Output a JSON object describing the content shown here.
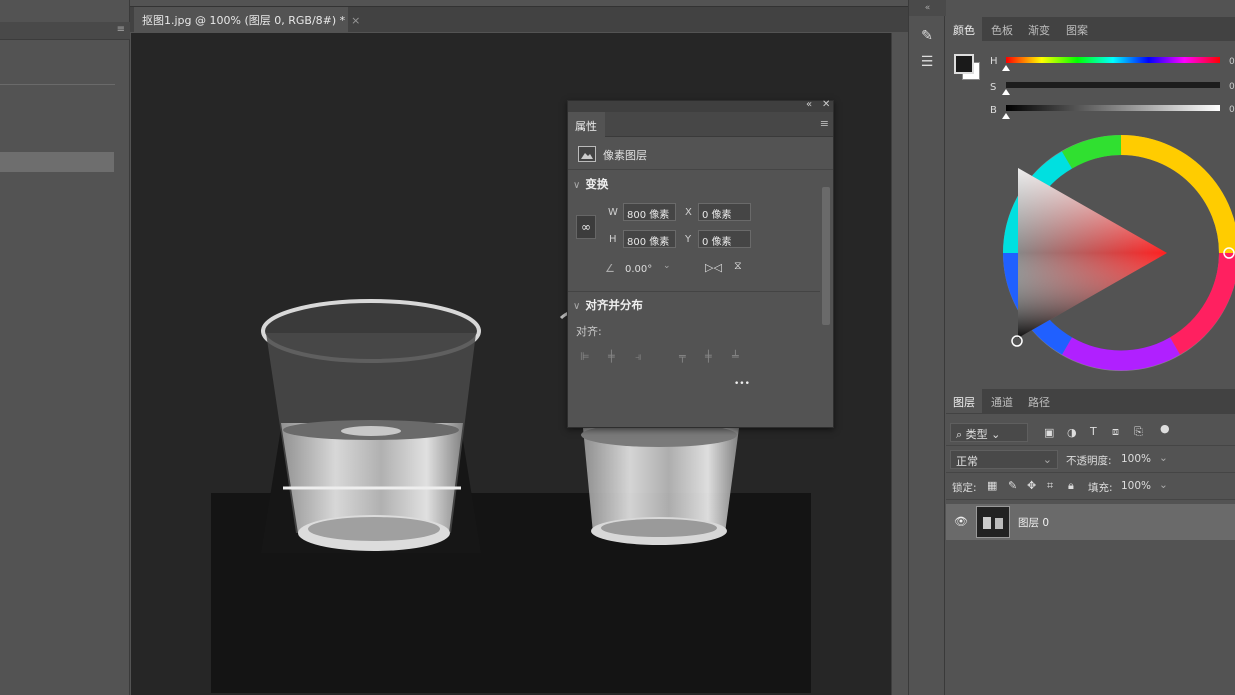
{
  "document": {
    "tab_title": "抠图1.jpg @ 100% (图层 0, RGB/8#) *",
    "tab_close": "×"
  },
  "properties": {
    "tab": "属性",
    "layer_type": "像素图层",
    "transform": {
      "title": "变换",
      "w_label": "W",
      "w_value": "800 像素",
      "h_label": "H",
      "h_value": "800 像素",
      "x_label": "X",
      "x_value": "0 像素",
      "y_label": "Y",
      "y_value": "0 像素",
      "angle": "0.00°"
    },
    "align": {
      "title": "对齐并分布",
      "label": "对齐:",
      "more": "•••"
    }
  },
  "color_panel": {
    "tabs": [
      "颜色",
      "色板",
      "渐变",
      "图案"
    ],
    "active_tab": 0,
    "h_label": "H",
    "s_label": "S",
    "b_label": "B",
    "h_value": "0",
    "s_value": "0",
    "b_value": "0",
    "foreground_color": "#1a1a1a",
    "background_color": "#ffffff"
  },
  "layers_panel": {
    "tabs": [
      "图层",
      "通道",
      "路径"
    ],
    "active_tab": 0,
    "filter_kind": "类型",
    "blend_mode": "正常",
    "opacity_label": "不透明度:",
    "opacity_value": "100%",
    "lock_label": "锁定:",
    "fill_label": "填充:",
    "fill_value": "100%",
    "layers": [
      {
        "name": "图层 0",
        "visible": true
      }
    ]
  }
}
